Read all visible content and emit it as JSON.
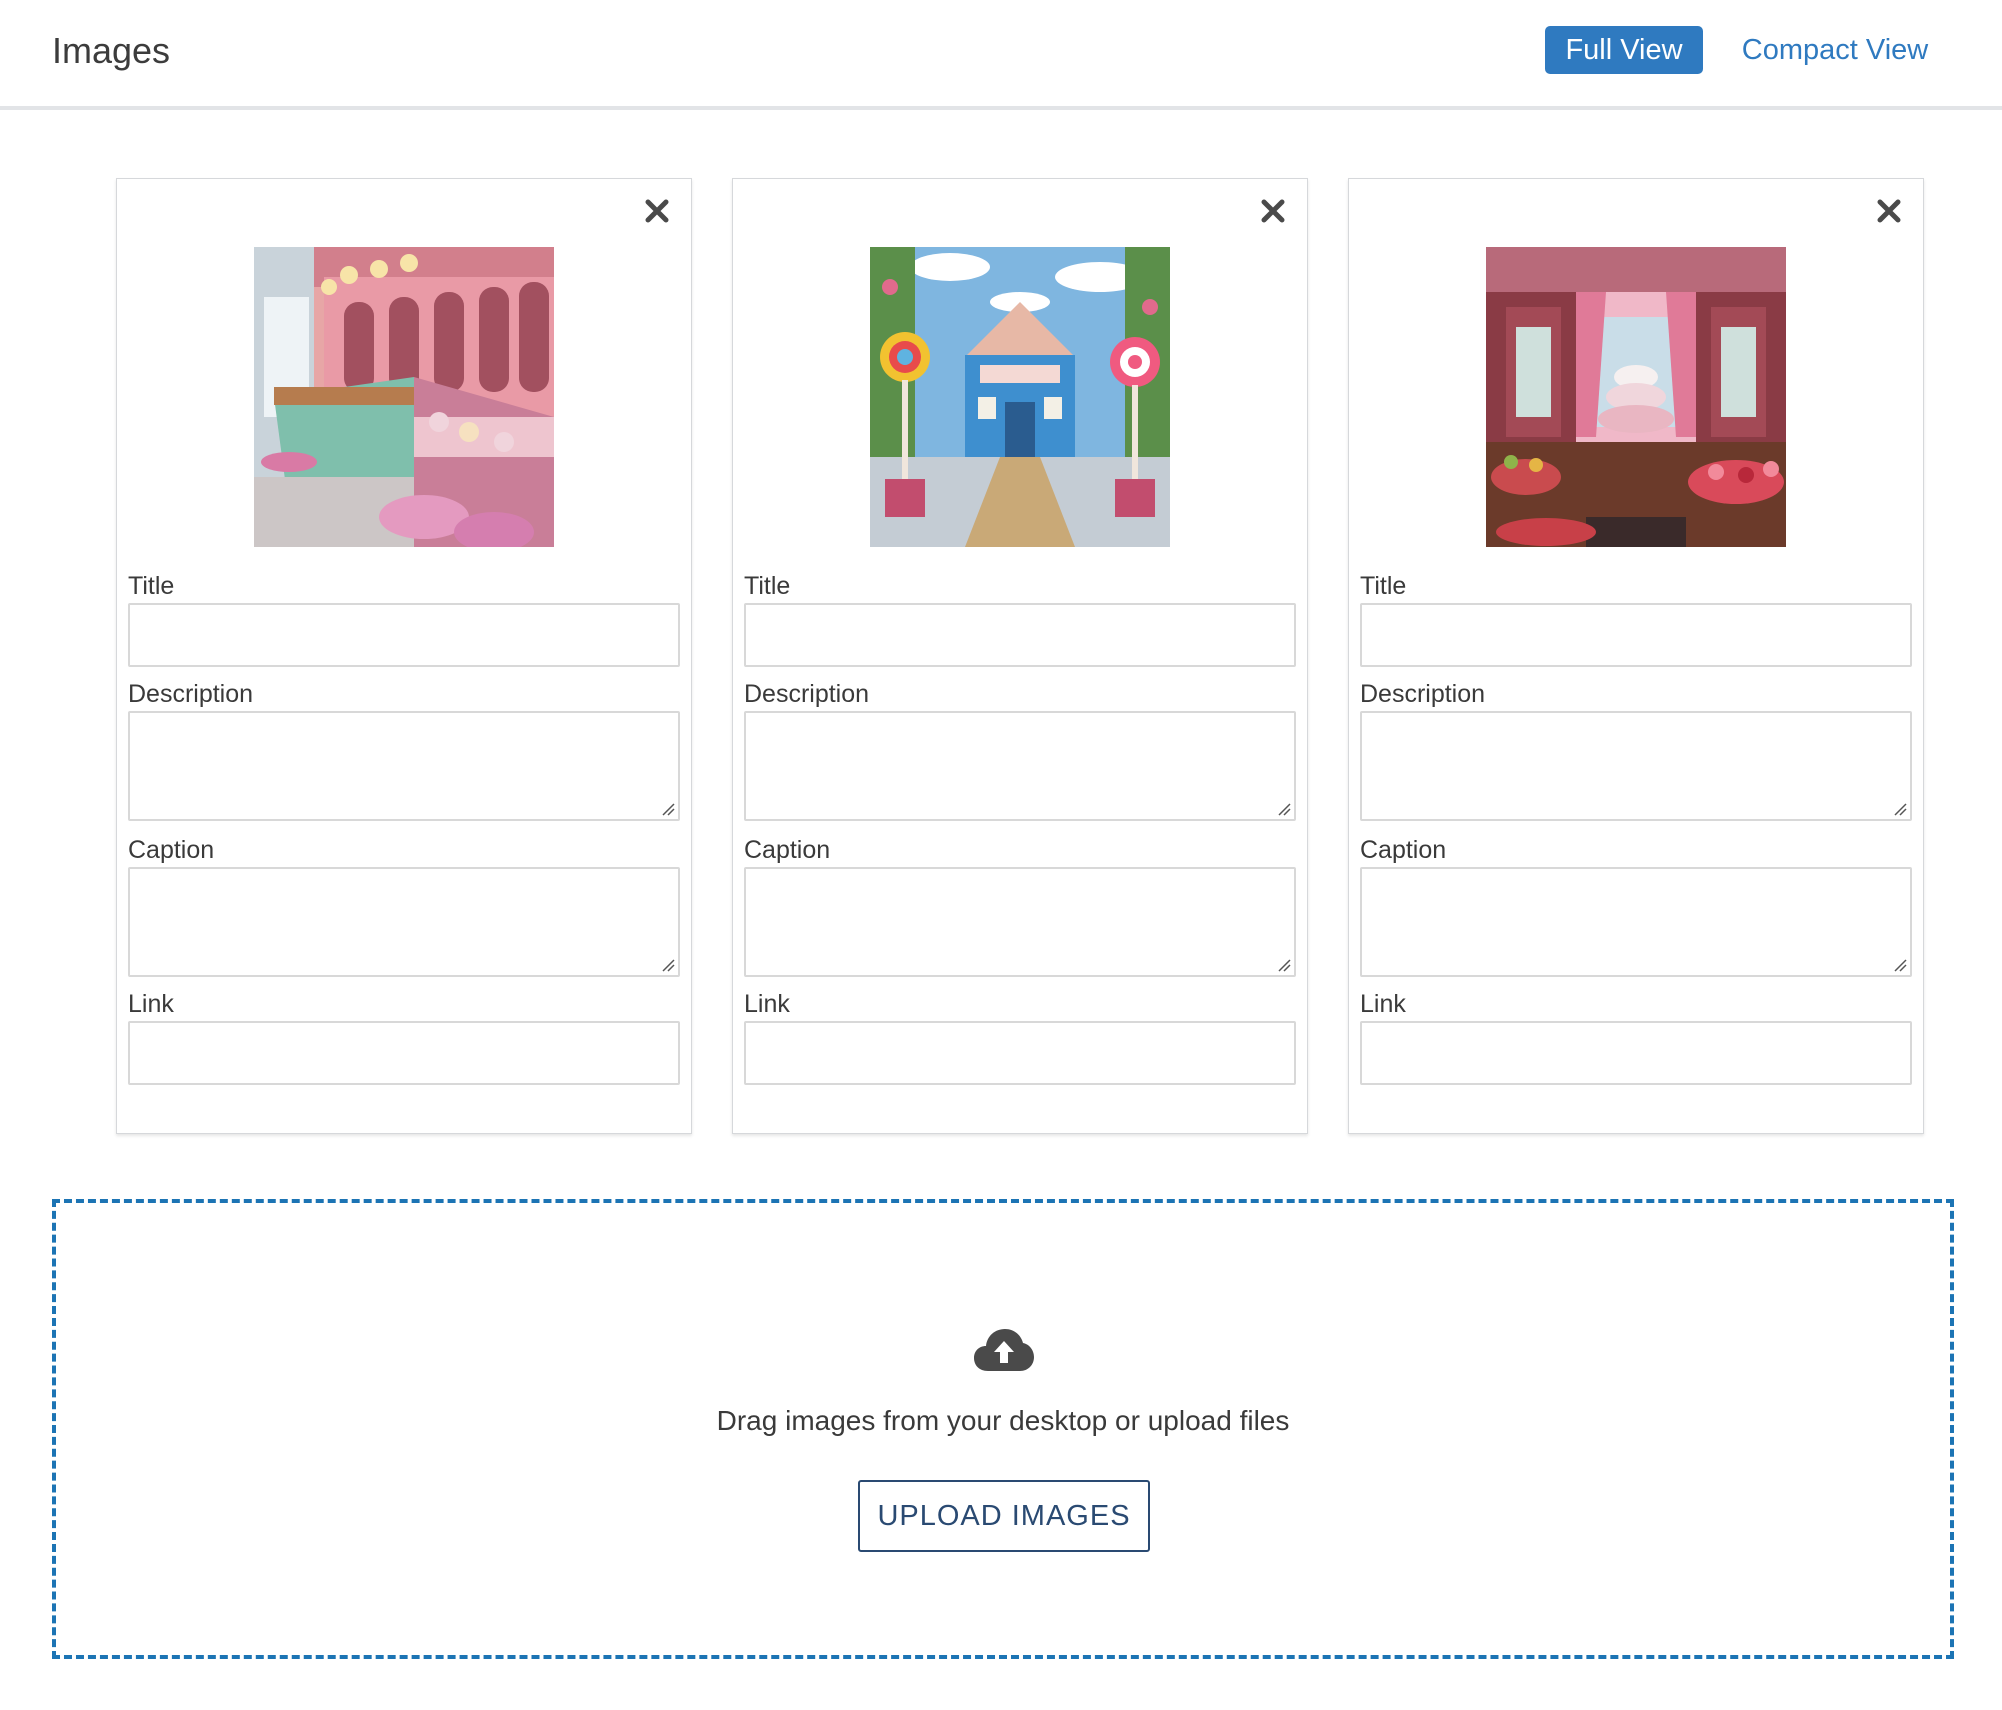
{
  "header": {
    "title": "Images",
    "full_view_label": "Full View",
    "compact_view_label": "Compact View",
    "active_view": "Full View",
    "accent_color": "#2f7ac0"
  },
  "cards": [
    {
      "image_description": "pink and mint candy shop interior",
      "title_label": "Title",
      "title_value": "",
      "description_label": "Description",
      "description_value": "",
      "caption_label": "Caption",
      "caption_value": "",
      "link_label": "Link",
      "link_value": ""
    },
    {
      "image_description": "blue candy house with lollipops and cobblestone path",
      "title_label": "Title",
      "title_value": "",
      "description_label": "Description",
      "description_value": "",
      "caption_label": "Caption",
      "caption_value": "",
      "link_label": "Link",
      "link_value": ""
    },
    {
      "image_description": "red and pink sweets shop with cake display",
      "title_label": "Title",
      "title_value": "",
      "description_label": "Description",
      "description_value": "",
      "caption_label": "Caption",
      "caption_value": "",
      "link_label": "Link",
      "link_value": ""
    }
  ],
  "dropzone": {
    "icon": "cloud-upload-icon",
    "text": "Drag images from your desktop or upload files",
    "button_label": "UPLOAD IMAGES",
    "border_color": "#1c74b4"
  }
}
